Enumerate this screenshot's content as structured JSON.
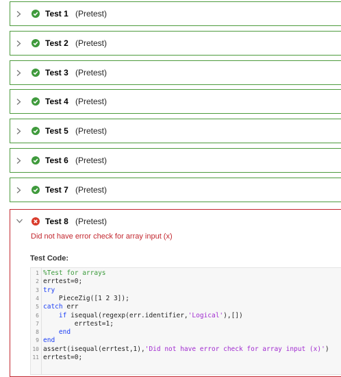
{
  "tests": [
    {
      "name": "Test 1",
      "type": "(Pretest)",
      "status": "passed"
    },
    {
      "name": "Test 2",
      "type": "(Pretest)",
      "status": "passed"
    },
    {
      "name": "Test 3",
      "type": "(Pretest)",
      "status": "passed"
    },
    {
      "name": "Test 4",
      "type": "(Pretest)",
      "status": "passed"
    },
    {
      "name": "Test 5",
      "type": "(Pretest)",
      "status": "passed"
    },
    {
      "name": "Test 6",
      "type": "(Pretest)",
      "status": "passed"
    },
    {
      "name": "Test 7",
      "type": "(Pretest)",
      "status": "passed"
    }
  ],
  "failed_test": {
    "name": "Test 8",
    "type": "(Pretest)",
    "status": "failed",
    "error_message": "Did not have error check for array input (x)",
    "test_code_label": "Test Code:",
    "code_lines": [
      {
        "num": "1",
        "parts": [
          {
            "t": "%Test for arrays",
            "c": "cm"
          }
        ]
      },
      {
        "num": "2",
        "parts": [
          {
            "t": "errtest=0;",
            "c": ""
          }
        ]
      },
      {
        "num": "3",
        "parts": [
          {
            "t": "try",
            "c": "kw"
          }
        ]
      },
      {
        "num": "4",
        "parts": [
          {
            "t": "    PieceZig([1 2 3]);",
            "c": ""
          }
        ]
      },
      {
        "num": "5",
        "parts": [
          {
            "t": "catch",
            "c": "kw"
          },
          {
            "t": " err",
            "c": ""
          }
        ]
      },
      {
        "num": "6",
        "parts": [
          {
            "t": "    ",
            "c": ""
          },
          {
            "t": "if",
            "c": "kw"
          },
          {
            "t": " isequal(regexp(err.identifier,",
            "c": ""
          },
          {
            "t": "'Logical'",
            "c": "st"
          },
          {
            "t": "),[])",
            "c": ""
          }
        ]
      },
      {
        "num": "7",
        "parts": [
          {
            "t": "        errtest=1;",
            "c": ""
          }
        ]
      },
      {
        "num": "8",
        "parts": [
          {
            "t": "    ",
            "c": ""
          },
          {
            "t": "end",
            "c": "kw"
          }
        ]
      },
      {
        "num": "9",
        "parts": [
          {
            "t": "end",
            "c": "kw"
          }
        ]
      },
      {
        "num": "10",
        "parts": [
          {
            "t": "assert(isequal(errtest,1),",
            "c": ""
          },
          {
            "t": "'Did not have error check for array input (x)'",
            "c": "st"
          },
          {
            "t": ")",
            "c": ""
          }
        ]
      },
      {
        "num": "11",
        "parts": [
          {
            "t": "errtest=0;",
            "c": ""
          }
        ]
      }
    ]
  },
  "colors": {
    "pass": "#4c9a3c",
    "fail": "#c2262e"
  },
  "icons": {
    "pass": "check-circle-icon",
    "fail": "x-circle-icon",
    "collapsed": "chevron-right-icon",
    "expanded": "chevron-down-icon"
  }
}
